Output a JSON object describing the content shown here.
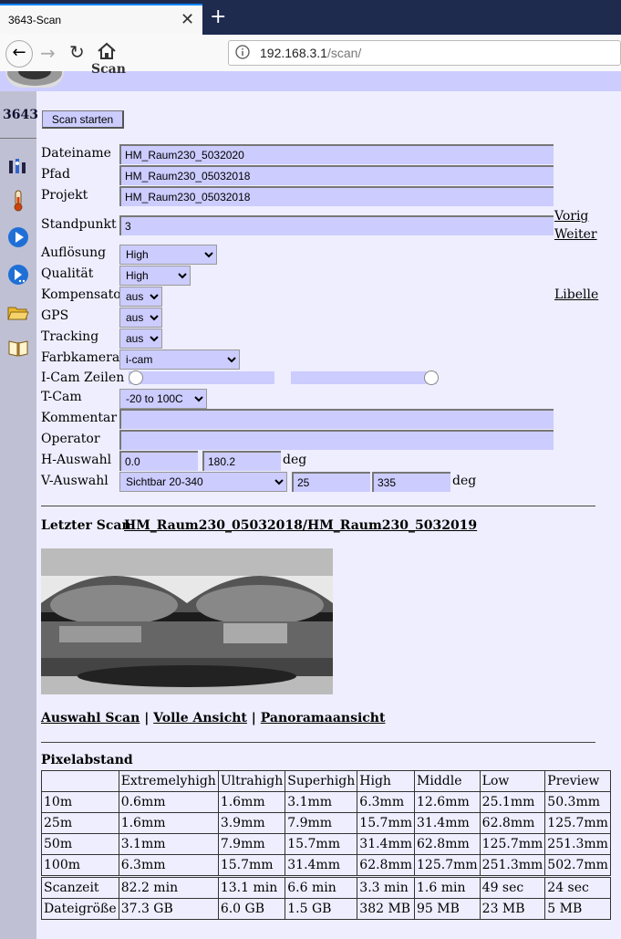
{
  "browser": {
    "tab_title": "3643-Scan",
    "url_host": "192.168.3.1",
    "url_path": "/scan/"
  },
  "header": {
    "title": "Scan"
  },
  "sidebar": {
    "device": "3643",
    "icons": [
      "settings-icon",
      "thermometer-icon",
      "play-icon",
      "play-more-icon",
      "folder-icon",
      "book-icon"
    ]
  },
  "form": {
    "start_button": "Scan starten",
    "dateiname_label": "Dateiname",
    "dateiname": "HM_Raum230_5032020",
    "pfad_label": "Pfad",
    "pfad": "HM_Raum230_05032018",
    "projekt_label": "Projekt",
    "projekt": "HM_Raum230_05032018",
    "standpunkt_label": "Standpunkt",
    "standpunkt": "3",
    "vorig": "Vorig",
    "weiter": "Weiter",
    "aufloesung_label": "Auflösung",
    "aufloesung": "High",
    "qualitaet_label": "Qualität",
    "qualitaet": "High",
    "kompensator_label": "Kompensator",
    "kompensator": "aus",
    "libelle": "Libelle",
    "gps_label": "GPS",
    "gps": "aus",
    "tracking_label": "Tracking",
    "tracking": "aus",
    "farbkamera_label": "Farbkamera",
    "farbkamera": "i-cam",
    "icam_label": "I-Cam Zeilen",
    "icam_slider_left": 0.0,
    "icam_slider_right": 1.0,
    "tcam_label": "T-Cam",
    "tcam": "-20 to 100C",
    "kommentar_label": "Kommentar",
    "kommentar": "",
    "operator_label": "Operator",
    "operator": "",
    "hauswahl_label": "H-Auswahl",
    "h_from": "0.0",
    "h_to": "180.2",
    "h_unit": "deg",
    "vauswahl_label": "V-Auswahl",
    "v_preset": "Sichtbar 20-340",
    "v_from": "25",
    "v_to": "335",
    "v_unit": "deg"
  },
  "last_scan": {
    "label": "Letzter Scan",
    "link": "HM_Raum230_05032018/HM_Raum230_5032019"
  },
  "views": {
    "auswahl": "Auswahl Scan",
    "sep": "|",
    "volle": "Volle Ansicht",
    "panorama": "Panoramaansicht"
  },
  "pixel": {
    "title": "Pixelabstand",
    "headers": [
      "",
      "Extremelyhigh",
      "Ultrahigh",
      "Superhigh",
      "High",
      "Middle",
      "Low",
      "Preview"
    ],
    "rows": [
      [
        "10m",
        "0.6mm",
        "1.6mm",
        "3.1mm",
        "6.3mm",
        "12.6mm",
        "25.1mm",
        "50.3mm"
      ],
      [
        "25m",
        "1.6mm",
        "3.9mm",
        "7.9mm",
        "15.7mm",
        "31.4mm",
        "62.8mm",
        "125.7mm"
      ],
      [
        "50m",
        "3.1mm",
        "7.9mm",
        "15.7mm",
        "31.4mm",
        "62.8mm",
        "125.7mm",
        "251.3mm"
      ],
      [
        "100m",
        "6.3mm",
        "15.7mm",
        "31.4mm",
        "62.8mm",
        "125.7mm",
        "251.3mm",
        "502.7mm"
      ]
    ],
    "stats": [
      [
        "Scanzeit",
        "82.2 min",
        "13.1 min",
        "6.6 min",
        "3.3 min",
        "1.6 min",
        "49 sec",
        "24 sec"
      ],
      [
        "Dateigröße",
        "37.3 GB",
        "6.0 GB",
        "1.5 GB",
        "382 MB",
        "95 MB",
        "23 MB",
        "5 MB"
      ]
    ]
  }
}
